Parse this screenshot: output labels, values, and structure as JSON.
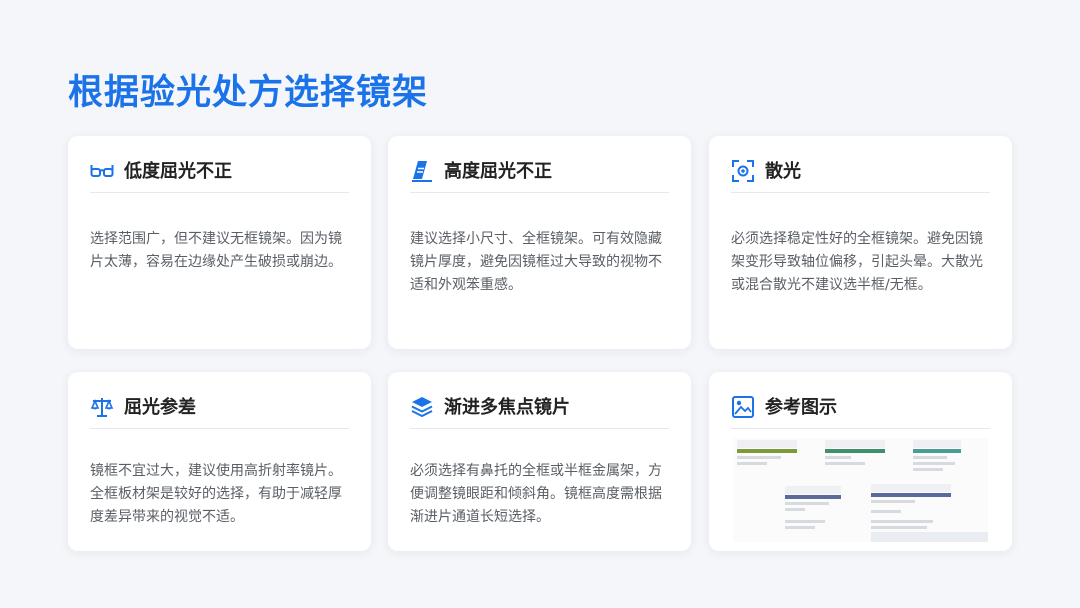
{
  "page": {
    "title": "根据验光处方选择镜架"
  },
  "cards": [
    {
      "title": "低度屈光不正",
      "icon": "glasses-icon",
      "body": "选择范围广，但不建议无框镜架。因为镜片太薄，容易在边缘处产生破损或崩边。"
    },
    {
      "title": "高度屈光不正",
      "icon": "thick-lens-icon",
      "body": "建议选择小尺寸、全框镜架。可有效隐藏镜片厚度，避免因镜框过大导致的视物不适和外观笨重感。"
    },
    {
      "title": "散光",
      "icon": "focus-target-icon",
      "body": "必须选择稳定性好的全框镜架。避免因镜架变形导致轴位偏移，引起头晕。大散光或混合散光不建议选半框/无框。"
    },
    {
      "title": "屈光参差",
      "icon": "balance-scale-icon",
      "body": "镜框不宜过大，建议使用高折射率镜片。全框板材架是较好的选择，有助于减轻厚度差异带来的视觉不适。"
    },
    {
      "title": "渐进多焦点镜片",
      "icon": "layers-icon",
      "body": "必须选择有鼻托的全框或半框金属架，方便调整镜眼距和倾斜角。镜框高度需根据渐进片通道长短选择。"
    },
    {
      "title": "参考图示",
      "icon": "image-icon",
      "body": ""
    }
  ],
  "colors": {
    "accent": "#1a73e8",
    "title": "#222222",
    "text": "#5a5f66"
  }
}
